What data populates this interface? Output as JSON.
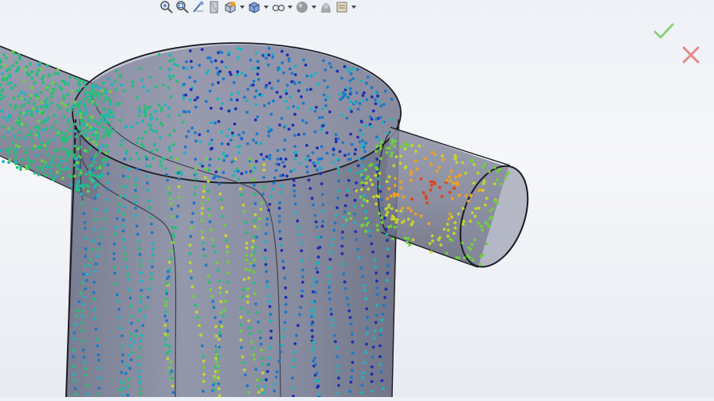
{
  "app": {
    "context": "flow-trajectory-view"
  },
  "toolbar": {
    "items": [
      {
        "icon": "zoom-to-fit-icon",
        "dropdown": false
      },
      {
        "icon": "zoom-to-area-icon",
        "dropdown": false
      },
      {
        "icon": "previous-view-icon",
        "dropdown": false
      },
      {
        "icon": "section-view-icon",
        "dropdown": false
      },
      {
        "icon": "view-orientation-icon",
        "dropdown": true
      },
      {
        "icon": "display-style-icon",
        "dropdown": true
      },
      {
        "icon": "hide-show-items-icon",
        "dropdown": true
      },
      {
        "icon": "edit-appearance-icon",
        "dropdown": true
      },
      {
        "icon": "apply-scene-icon",
        "dropdown": false
      },
      {
        "icon": "view-settings-icon",
        "dropdown": true
      }
    ]
  },
  "confirm": {
    "ok_icon": "checkmark-icon",
    "cancel_icon": "close-icon",
    "ok_color": "#8fd07f",
    "cancel_color": "#e28a8a"
  },
  "colors": {
    "body_fill": "#7c8094",
    "body_stroke": "#1b1d24",
    "palette": [
      "#1d2fb5",
      "#1b79c9",
      "#18b7c0",
      "#22c07a",
      "#6fd13a",
      "#c7d42a",
      "#f0a21e",
      "#e0431b"
    ]
  }
}
